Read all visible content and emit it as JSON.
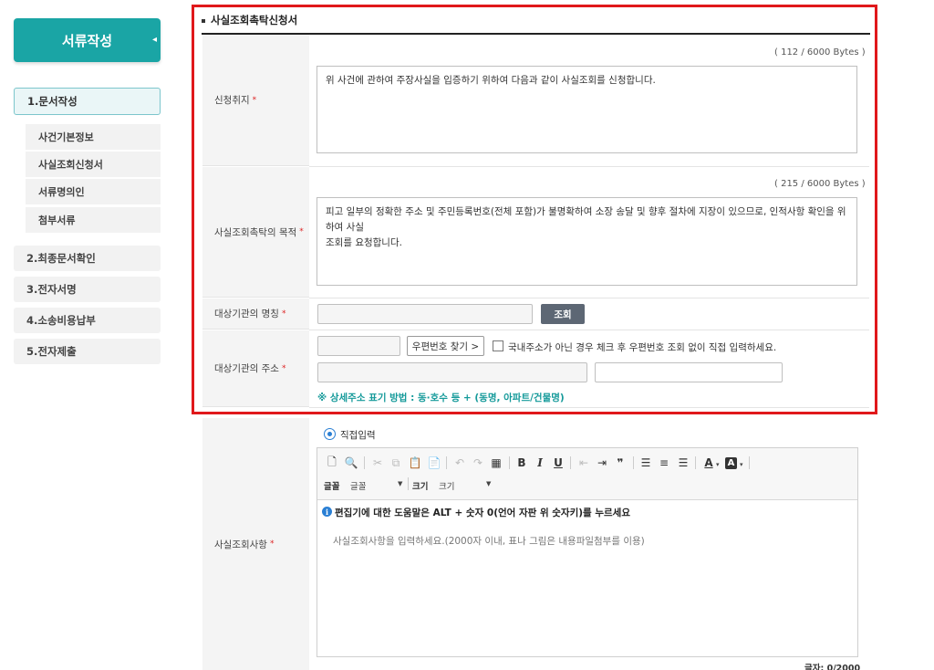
{
  "sidebar": {
    "title": "서류작성",
    "steps": [
      {
        "label": "1.문서작성"
      },
      {
        "label": "2.최종문서확인"
      },
      {
        "label": "3.전자서명"
      },
      {
        "label": "4.소송비용납부"
      },
      {
        "label": "5.전자제출"
      }
    ],
    "subitems": [
      {
        "label": "사건기본정보"
      },
      {
        "label": "사실조회신청서"
      },
      {
        "label": "서류명의인"
      },
      {
        "label": "첨부서류"
      }
    ]
  },
  "section": {
    "title": "사실조회촉탁신청서"
  },
  "form": {
    "purpose_of_request": {
      "label": "신청취지",
      "bytes": "( 112 / 6000 Bytes )",
      "value": "위 사건에 관하여 주장사실을 입증하기 위하여 다음과 같이 사실조회를 신청합니다."
    },
    "objective": {
      "label": "사실조회촉탁의 목적",
      "bytes": "( 215 / 6000 Bytes )",
      "value_line1": "피고 일부의 정확한 주소 및 주민등록번호(전체 포함)가 불명확하여 소장 송달 및 향후 절차에 지장이 있으므로, 인적사항 확인을 위하여 사실",
      "value_line2": "조회를 요청합니다."
    },
    "agency_name": {
      "label": "대상기관의 명칭",
      "value": "",
      "search_button": "조회"
    },
    "agency_address": {
      "label": "대상기관의 주소",
      "postal_button": "우편번호 찾기 >",
      "foreign_checkbox_label": "국내주소가 아닌 경우 체크 후 우편번호 조회 없이 직접 입력하세요.",
      "foreign_checked": false,
      "note": "※ 상세주소 표기 방법 : 동·호수 등 + (동명, 아파트/건물명)"
    },
    "inquiry_items": {
      "label": "사실조회사항",
      "mode_label": "직접입력",
      "toolbar": {
        "font_label": "글꼴",
        "font_value": "글꼴",
        "size_label": "크기",
        "size_value": "크기"
      },
      "editor_help": "편집기에 대한 도움말은 ALT + 숫자 0(언어 자판 위 숫자키)를 누르세요",
      "placeholder": "사실조회사항을 입력하세요.(2000자 이내, 표나 그림은 내용파일첨부를 이용)",
      "char_count": "글자: 0/2000"
    }
  },
  "colors": {
    "brand": "#1aa5a5",
    "highlight": "#e0181b",
    "required": "#dd2222",
    "note": "#159a9a"
  }
}
